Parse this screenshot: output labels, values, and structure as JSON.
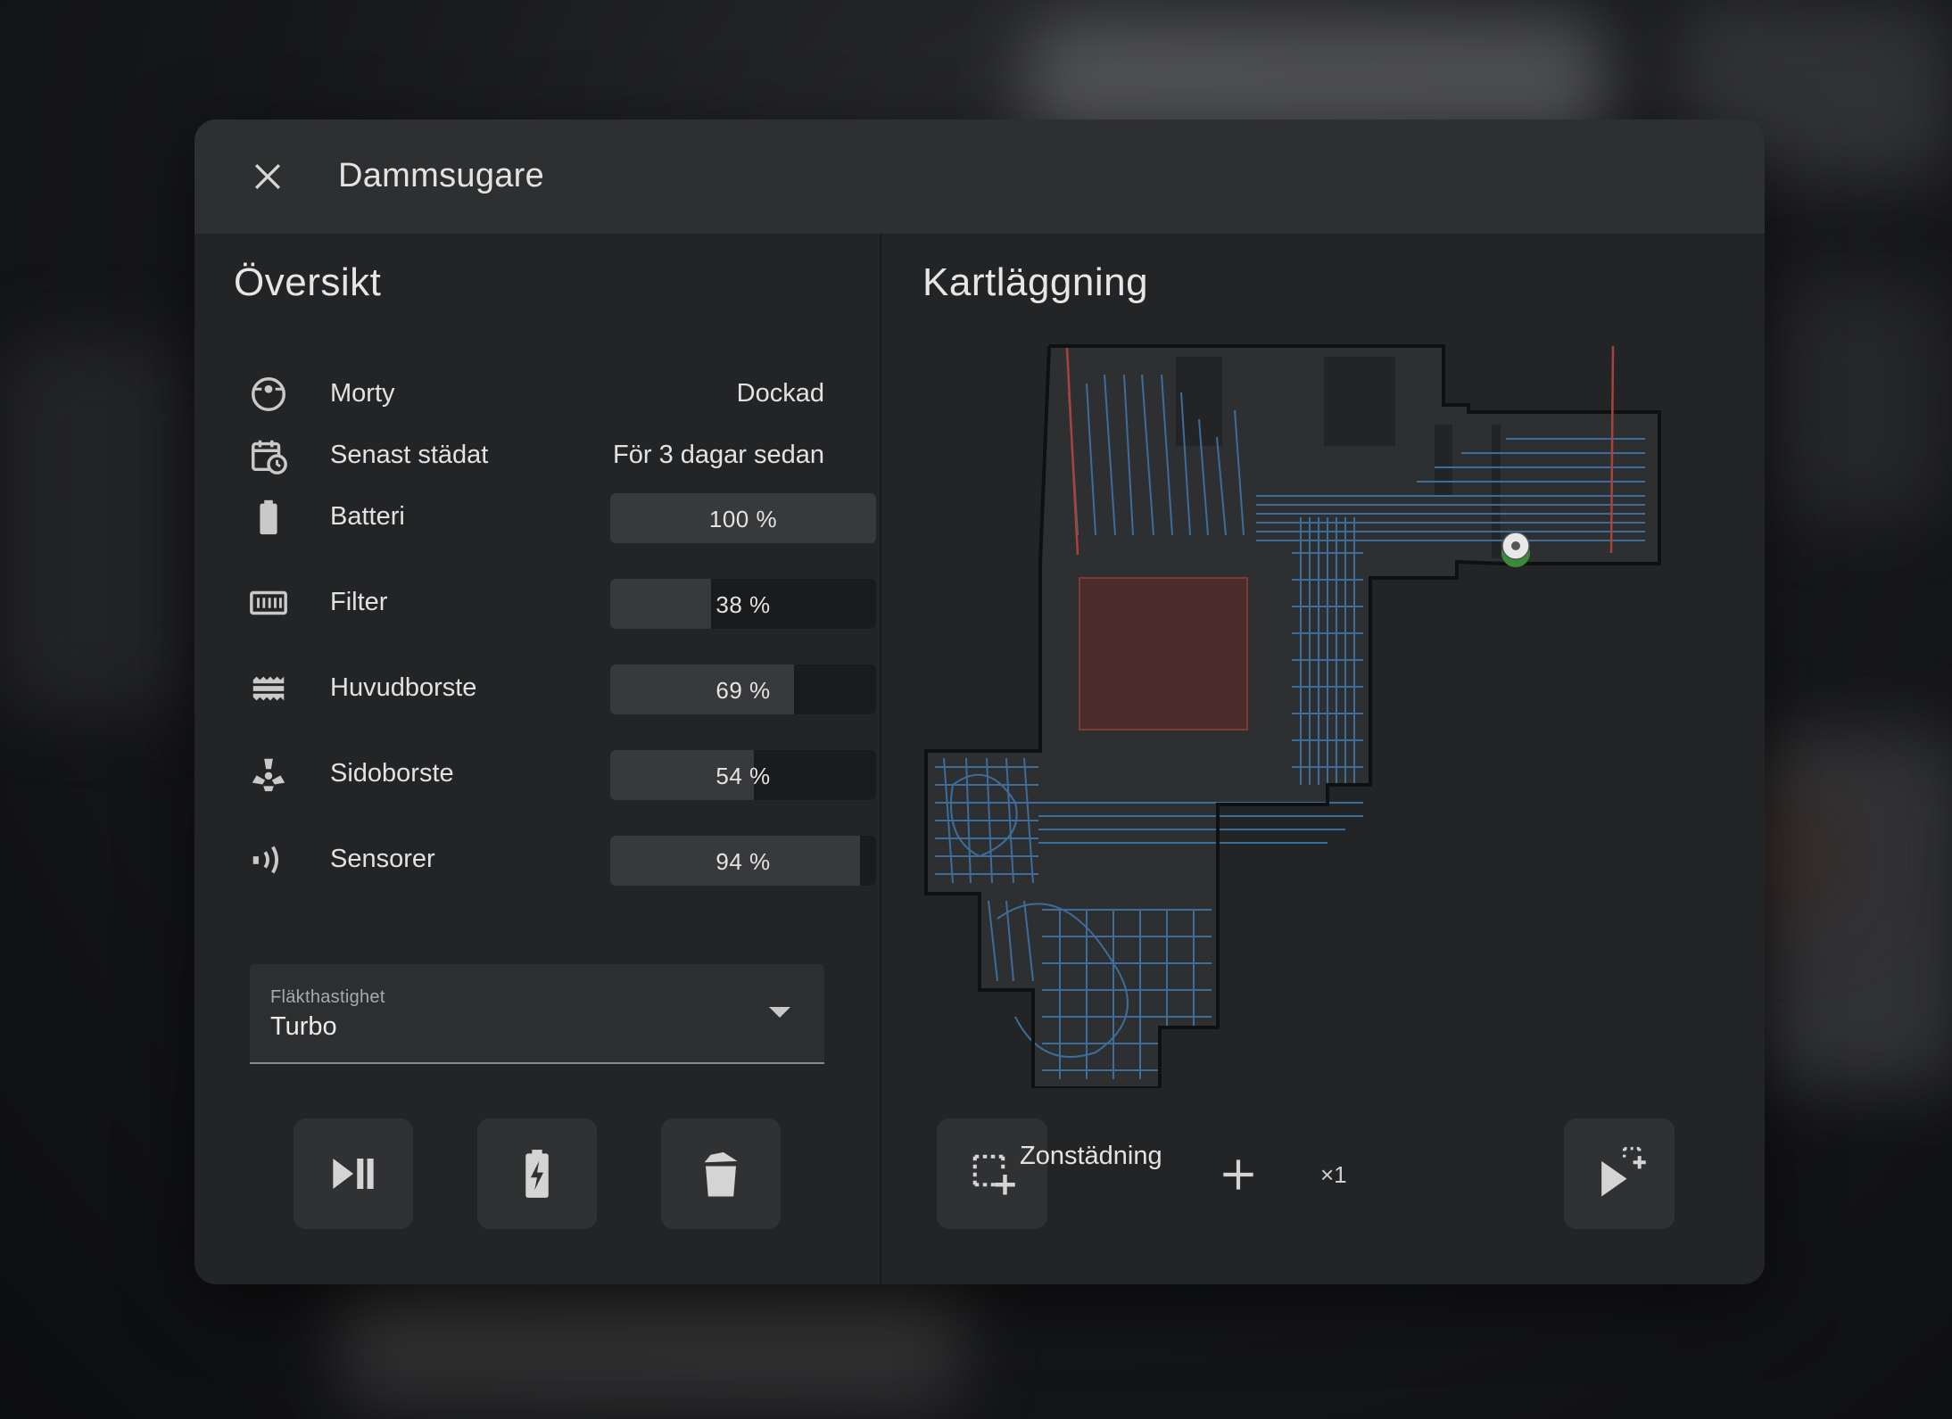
{
  "dialog": {
    "title": "Dammsugare"
  },
  "overview": {
    "title": "Översikt",
    "status": {
      "label": "Morty",
      "value": "Dockad",
      "icon": "robot-vacuum-icon"
    },
    "last_clean": {
      "label": "Senast städat",
      "value": "För 3 dagar sedan",
      "icon": "calendar-clock-icon"
    },
    "consumables": [
      {
        "label": "Batteri",
        "value_text": "100 %",
        "percent": 100,
        "icon": "battery-icon"
      },
      {
        "label": "Filter",
        "value_text": "38 %",
        "percent": 38,
        "icon": "air-filter-icon"
      },
      {
        "label": "Huvudborste",
        "value_text": "69 %",
        "percent": 69,
        "icon": "main-brush-icon"
      },
      {
        "label": "Sidoborste",
        "value_text": "54 %",
        "percent": 54,
        "icon": "side-brush-icon"
      },
      {
        "label": "Sensorer",
        "value_text": "94 %",
        "percent": 94,
        "icon": "sensor-icon"
      }
    ],
    "fan_speed": {
      "label": "Fläkthastighet",
      "value": "Turbo"
    },
    "actions": [
      "play-pause-icon",
      "battery-charging-icon",
      "trash-can-icon"
    ]
  },
  "mapping": {
    "title": "Kartläggning",
    "zone_label": "Zonstädning",
    "repeat": "×1",
    "icons": [
      "select-zone-icon",
      "plus-icon",
      "play-zone-icon"
    ]
  },
  "colors": {
    "accent_path": "#3f74a6",
    "zone_fill": "#4a2c2a",
    "dialog_bg": "#232426",
    "header_bg": "#2e2f31"
  }
}
